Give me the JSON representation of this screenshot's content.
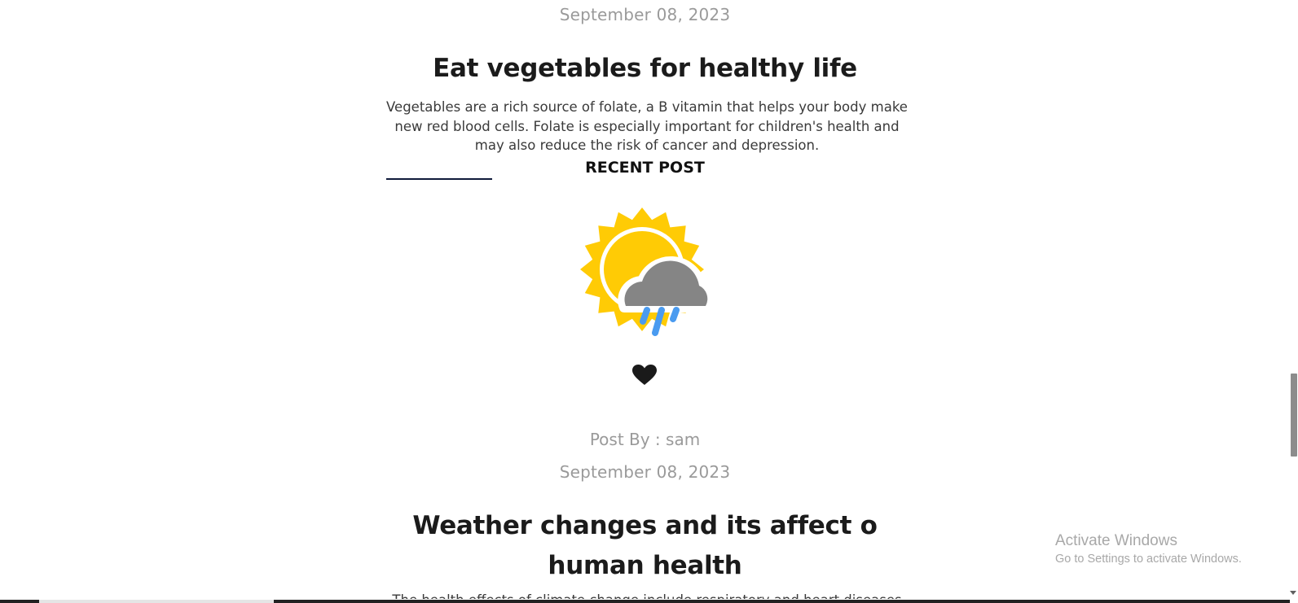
{
  "post1": {
    "date": "September 08, 2023",
    "title": "Eat vegetables for healthy life",
    "excerpt": "Vegetables are a rich source of folate, a B vitamin that helps your body make new red blood cells. Folate is especially important for children's health and may also reduce the risk of cancer and depression."
  },
  "recent": {
    "label": "RECENT POST"
  },
  "post2": {
    "image_icon": "sun-cloud-rain-icon",
    "like_icon": "heart-icon",
    "author": "Post By : sam",
    "date": "September 08, 2023",
    "title_line1": "Weather changes and its affect o",
    "title_line2": "human health",
    "excerpt_partial": "The health effects of climate change include respiratory and heart diseases"
  },
  "watermark": {
    "title": "Activate Windows",
    "subtitle": "Go to Settings to activate Windows."
  },
  "colors": {
    "sun": "#FFCB05",
    "cloud": "#858585",
    "rain": "#4A9BF0",
    "underline": "#0F1A3A"
  }
}
